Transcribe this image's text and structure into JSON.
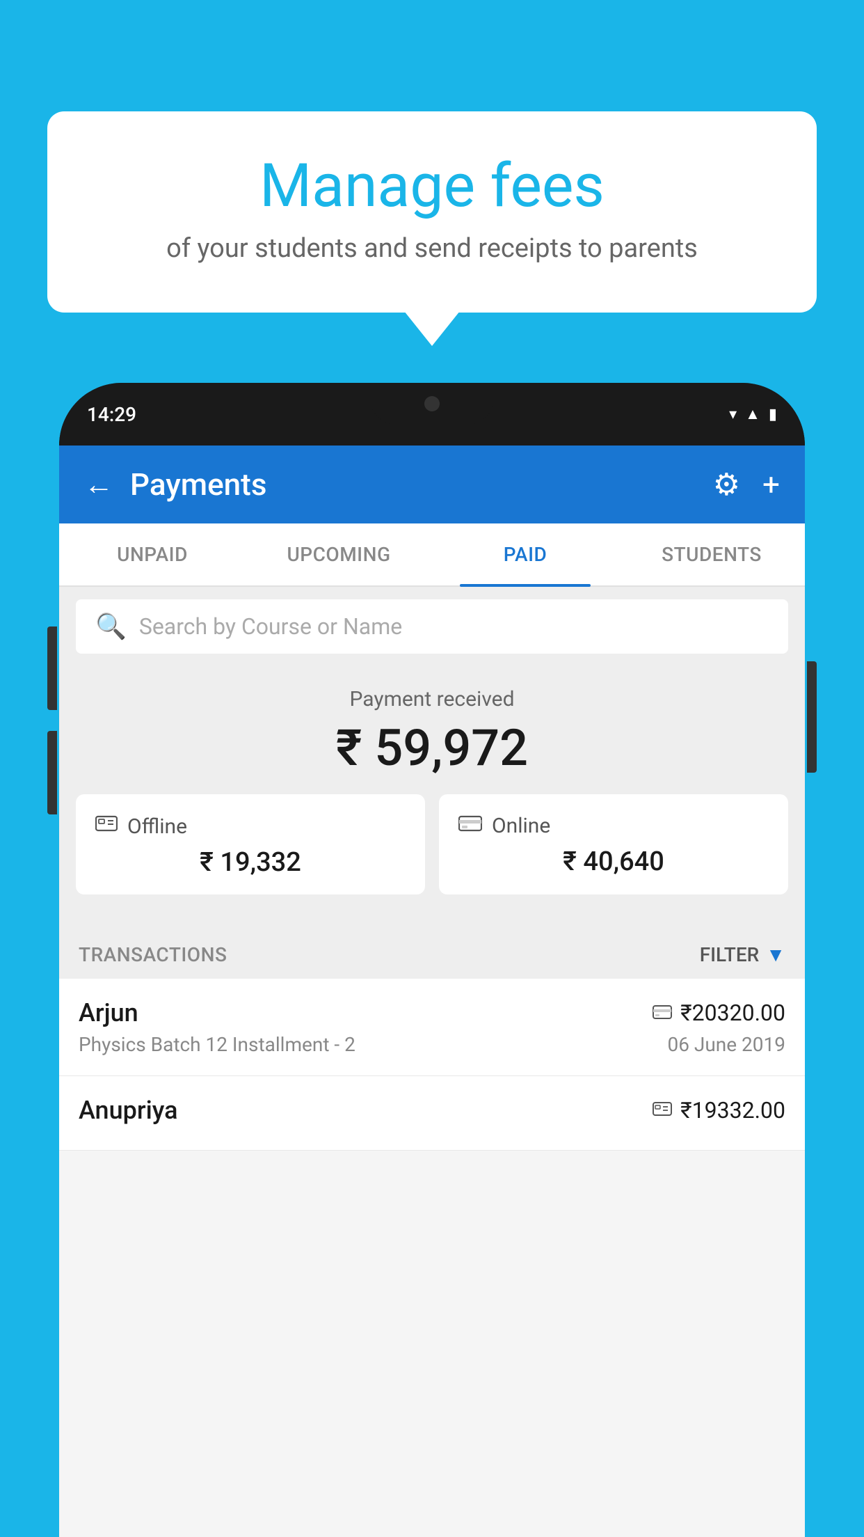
{
  "background_color": "#1ab5e8",
  "speech_bubble": {
    "title": "Manage fees",
    "subtitle": "of your students and send receipts to parents"
  },
  "phone": {
    "status_bar": {
      "time": "14:29"
    },
    "header": {
      "back_label": "←",
      "title": "Payments",
      "settings_icon": "⚙",
      "add_icon": "+"
    },
    "tabs": [
      {
        "label": "UNPAID",
        "active": false
      },
      {
        "label": "UPCOMING",
        "active": false
      },
      {
        "label": "PAID",
        "active": true
      },
      {
        "label": "STUDENTS",
        "active": false
      }
    ],
    "search": {
      "placeholder": "Search by Course or Name"
    },
    "payment_summary": {
      "label": "Payment received",
      "amount": "₹ 59,972",
      "offline_label": "Offline",
      "offline_amount": "₹ 19,332",
      "online_label": "Online",
      "online_amount": "₹ 40,640"
    },
    "transactions": {
      "section_label": "TRANSACTIONS",
      "filter_label": "FILTER",
      "rows": [
        {
          "name": "Arjun",
          "amount": "₹20320.00",
          "description": "Physics Batch 12 Installment - 2",
          "date": "06 June 2019",
          "payment_type": "online"
        },
        {
          "name": "Anupriya",
          "amount": "₹19332.00",
          "description": "",
          "date": "",
          "payment_type": "offline"
        }
      ]
    }
  }
}
